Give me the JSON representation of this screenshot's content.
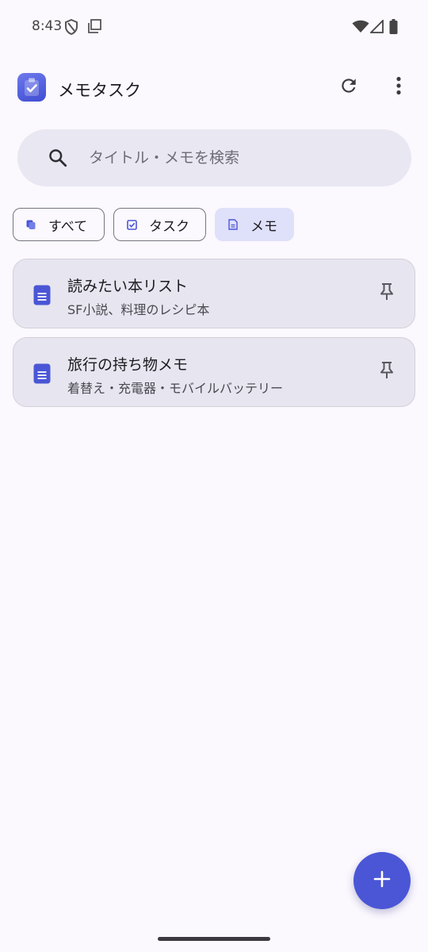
{
  "status_bar": {
    "time": "8:43",
    "icons": [
      "shield-icon",
      "screenshot-icon",
      "wifi-icon",
      "signal-icon",
      "battery-icon"
    ]
  },
  "app_bar": {
    "title": "メモタスク",
    "logo_icon": "app-logo-icon",
    "actions": [
      "refresh-icon",
      "more-vert-icon"
    ]
  },
  "search": {
    "placeholder": "タイトル・メモを検索",
    "value": "",
    "icon": "search-icon"
  },
  "filters": {
    "chips": [
      {
        "label": "すべて",
        "icon": "all-icon",
        "selected": false
      },
      {
        "label": "タスク",
        "icon": "checkbox-icon",
        "selected": false
      },
      {
        "label": "メモ",
        "icon": "document-icon",
        "selected": true
      }
    ]
  },
  "memos": [
    {
      "title": "読みたい本リスト",
      "subtitle": "SF小説、料理のレシピ本",
      "icon": "document-icon",
      "pin_icon": "pin-icon"
    },
    {
      "title": "旅行の持ち物メモ",
      "subtitle": "着替え・充電器・モバイルバッテリー",
      "icon": "document-icon",
      "pin_icon": "pin-icon"
    }
  ],
  "fab": {
    "icon": "add-icon"
  },
  "colors": {
    "background": "#FBF8FE",
    "accent": "#4A56D5",
    "card_background": "#E7E5EF",
    "chip_selected": "#DFE0F9",
    "search_background": "#E9E7F1"
  }
}
